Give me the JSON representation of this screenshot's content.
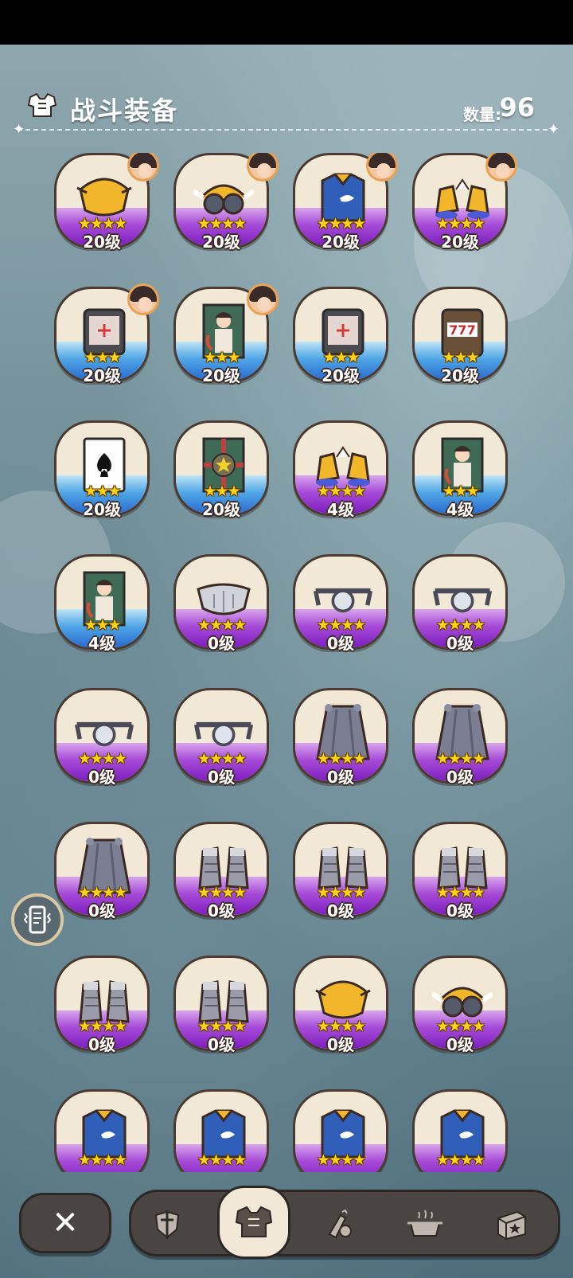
{
  "header": {
    "title": "战斗装备",
    "count_label": "数量:",
    "count_value": "96",
    "icon": "armor-icon"
  },
  "items": [
    {
      "icon": "helmet-icon",
      "stars": "★★★★",
      "level": "20级",
      "band": "purple",
      "avatar": true
    },
    {
      "icon": "goggles-icon",
      "stars": "★★★★",
      "level": "20级",
      "band": "purple",
      "avatar": true
    },
    {
      "icon": "jacket-icon",
      "stars": "★★★★",
      "level": "20级",
      "band": "purple",
      "avatar": true
    },
    {
      "icon": "boots-icon",
      "stars": "★★★★",
      "level": "20级",
      "band": "purple",
      "avatar": true
    },
    {
      "icon": "device-icon",
      "stars": "★★★",
      "level": "20级",
      "band": "blue",
      "avatar": true
    },
    {
      "icon": "portrait-card-icon",
      "stars": "★★★",
      "level": "20级",
      "band": "blue",
      "avatar": true
    },
    {
      "icon": "device-icon",
      "stars": "★★★",
      "level": "20级",
      "band": "blue",
      "avatar": false
    },
    {
      "icon": "slot-machine-icon",
      "stars": "★★★",
      "level": "20级",
      "band": "blue",
      "avatar": false
    },
    {
      "icon": "spade-card-icon",
      "stars": "★★★",
      "level": "20级",
      "band": "blue",
      "avatar": false
    },
    {
      "icon": "star-card-icon",
      "stars": "★★★",
      "level": "20级",
      "band": "blue",
      "avatar": false
    },
    {
      "icon": "boots-icon",
      "stars": "★★★★",
      "level": "4级",
      "band": "purple",
      "avatar": false
    },
    {
      "icon": "portrait-card-icon",
      "stars": "★★★",
      "level": "4级",
      "band": "blue",
      "avatar": false
    },
    {
      "icon": "portrait-card-icon",
      "stars": "★★★",
      "level": "4级",
      "band": "blue",
      "avatar": false
    },
    {
      "icon": "mask-icon",
      "stars": "★★★★",
      "level": "0级",
      "band": "purple",
      "avatar": false
    },
    {
      "icon": "glasses-icon",
      "stars": "★★★★",
      "level": "0级",
      "band": "purple",
      "avatar": false
    },
    {
      "icon": "glasses-icon",
      "stars": "★★★★",
      "level": "0级",
      "band": "purple",
      "avatar": false
    },
    {
      "icon": "glasses-icon",
      "stars": "★★★★",
      "level": "0级",
      "band": "purple",
      "avatar": false
    },
    {
      "icon": "glasses-icon",
      "stars": "★★★★",
      "level": "0级",
      "band": "purple",
      "avatar": false
    },
    {
      "icon": "cape-icon",
      "stars": "★★★★",
      "level": "0级",
      "band": "purple",
      "avatar": false
    },
    {
      "icon": "cape-icon",
      "stars": "★★★★",
      "level": "0级",
      "band": "purple",
      "avatar": false
    },
    {
      "icon": "cape-icon",
      "stars": "★★★★",
      "level": "0级",
      "band": "purple",
      "avatar": false
    },
    {
      "icon": "metal-boots-icon",
      "stars": "★★★★",
      "level": "0级",
      "band": "purple",
      "avatar": false
    },
    {
      "icon": "metal-boots-icon",
      "stars": "★★★★",
      "level": "0级",
      "band": "purple",
      "avatar": false
    },
    {
      "icon": "metal-boots-icon",
      "stars": "★★★★",
      "level": "0级",
      "band": "purple",
      "avatar": false
    },
    {
      "icon": "metal-boots-icon",
      "stars": "★★★★",
      "level": "0级",
      "band": "purple",
      "avatar": false
    },
    {
      "icon": "metal-boots-icon",
      "stars": "★★★★",
      "level": "0级",
      "band": "purple",
      "avatar": false
    },
    {
      "icon": "helmet-icon",
      "stars": "★★★★",
      "level": "0级",
      "band": "purple",
      "avatar": false
    },
    {
      "icon": "goggles-icon",
      "stars": "★★★★",
      "level": "0级",
      "band": "purple",
      "avatar": false
    },
    {
      "icon": "jacket-icon",
      "stars": "★★★★",
      "level": "",
      "band": "purple",
      "avatar": false
    },
    {
      "icon": "jacket-icon",
      "stars": "★★★★",
      "level": "",
      "band": "purple",
      "avatar": false
    },
    {
      "icon": "jacket-icon",
      "stars": "★★★★",
      "level": "",
      "band": "purple",
      "avatar": false
    },
    {
      "icon": "jacket-icon",
      "stars": "★★★★",
      "level": "",
      "band": "purple",
      "avatar": false
    }
  ],
  "bottom_bar": {
    "close_label": "✕",
    "tabs": [
      {
        "icon": "sword-shield-icon",
        "active": false
      },
      {
        "icon": "armor-icon",
        "active": true
      },
      {
        "icon": "crafting-icon",
        "active": false
      },
      {
        "icon": "cooking-pot-icon",
        "active": false
      },
      {
        "icon": "treasure-box-icon",
        "active": false
      }
    ]
  },
  "side_button": {
    "icon": "phone-vibrate-icon"
  },
  "colors": {
    "card_bg": "#f1e8d6",
    "band_purple": "#a64ad8",
    "band_blue": "#4fa6e6",
    "star": "#ffd21a",
    "bar_bg": "#4a4542"
  }
}
